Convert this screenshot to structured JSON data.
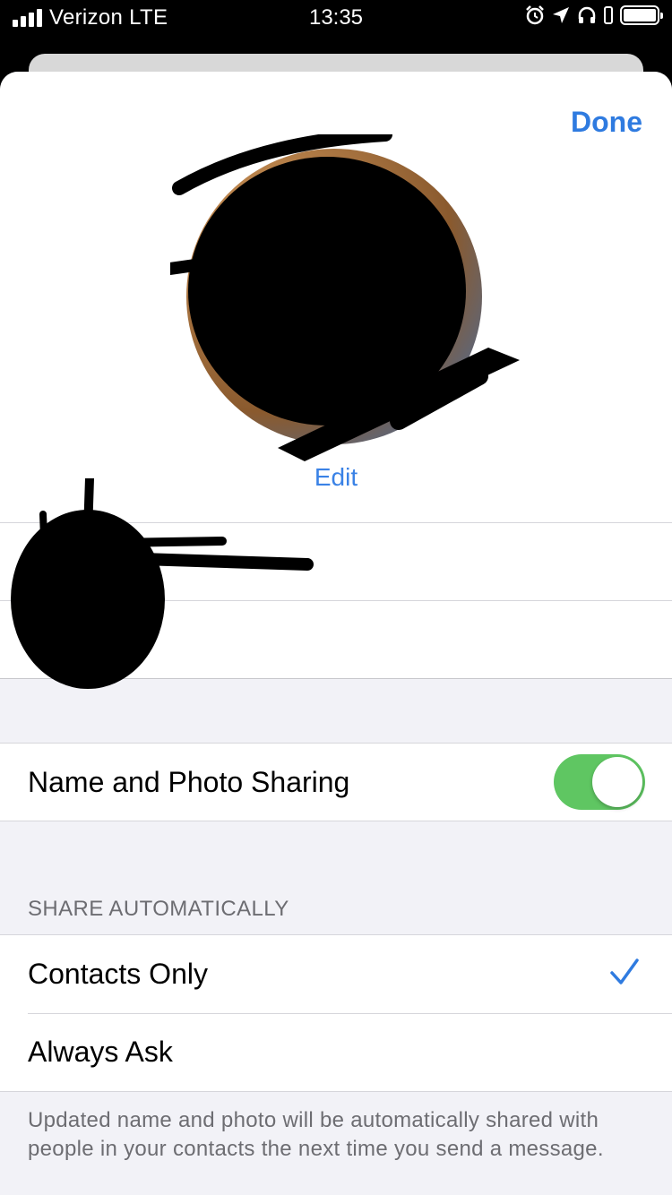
{
  "status_bar": {
    "carrier": "Verizon LTE",
    "time": "13:35"
  },
  "header": {
    "done_label": "Done"
  },
  "profile": {
    "edit_label": "Edit"
  },
  "settings": {
    "name_photo_sharing": {
      "label": "Name and Photo Sharing",
      "enabled": true
    },
    "share_automatically": {
      "header": "SHARE AUTOMATICALLY",
      "options": [
        {
          "label": "Contacts Only",
          "selected": true
        },
        {
          "label": "Always Ask",
          "selected": false
        }
      ],
      "footer": "Updated name and photo will be automatically shared with people in your contacts the next time you send a message."
    }
  },
  "colors": {
    "accent": "#2f7be0",
    "toggle_on": "#5fc662",
    "grouped_background": "#f2f2f7"
  }
}
